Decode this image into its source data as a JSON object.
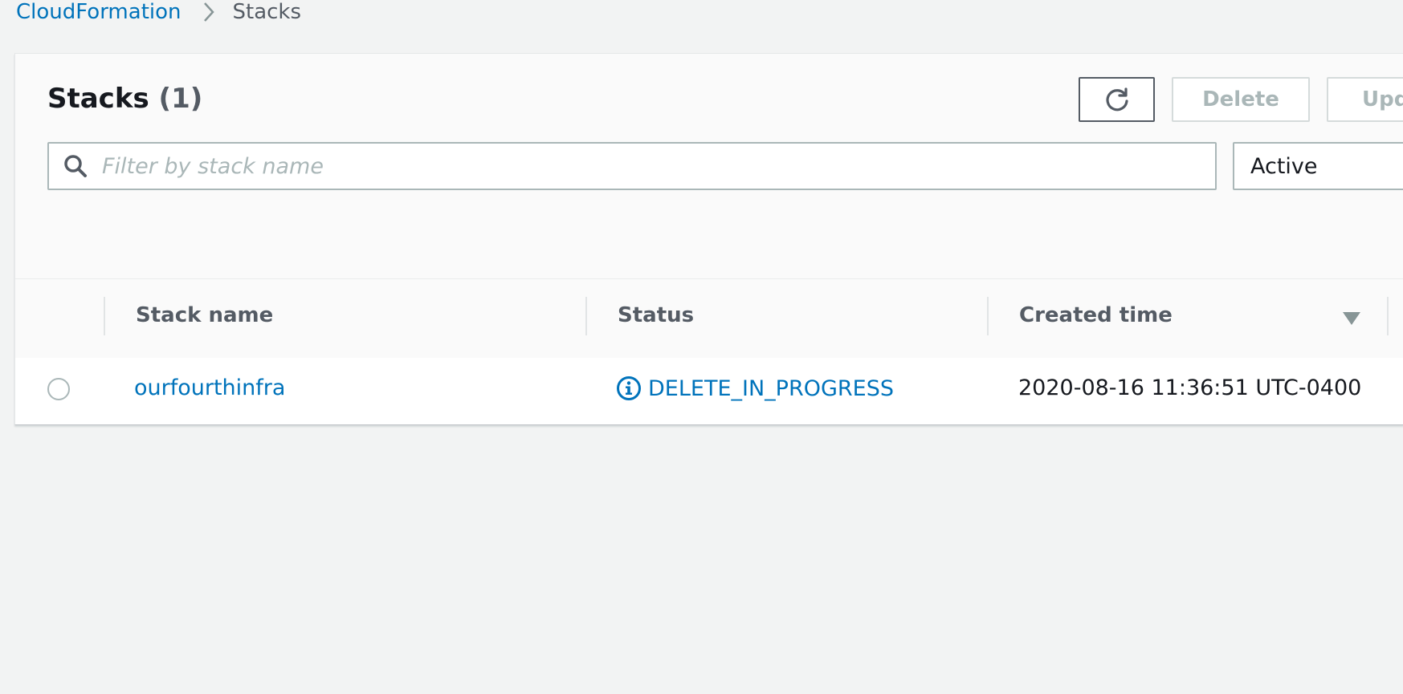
{
  "breadcrumb": {
    "items": [
      "CloudFormation",
      "Stacks"
    ]
  },
  "panel": {
    "title": "Stacks",
    "count": "(1)",
    "buttons": {
      "refresh_icon": "refresh-icon",
      "delete": "Delete",
      "update": "Upd"
    },
    "search": {
      "placeholder": "Filter by stack name",
      "value": "",
      "icon": "search-icon"
    },
    "filter_select": {
      "selected": "Active"
    }
  },
  "table": {
    "columns": [
      "Stack name",
      "Status",
      "Created time"
    ],
    "sort_column": "Created time",
    "sort_direction": "descending",
    "rows": [
      {
        "selected": false,
        "stack_name": "ourfourthinfra",
        "status": "DELETE_IN_PROGRESS",
        "status_icon": "info-icon",
        "created_time": "2020-08-16 11:36:51 UTC-0400"
      }
    ]
  },
  "colors": {
    "link": "#0073bb",
    "background": "#f2f3f3",
    "panel": "#fafafa",
    "disabled_text": "#aab7b8",
    "text": "#16191f",
    "secondary_text": "#545b64"
  }
}
